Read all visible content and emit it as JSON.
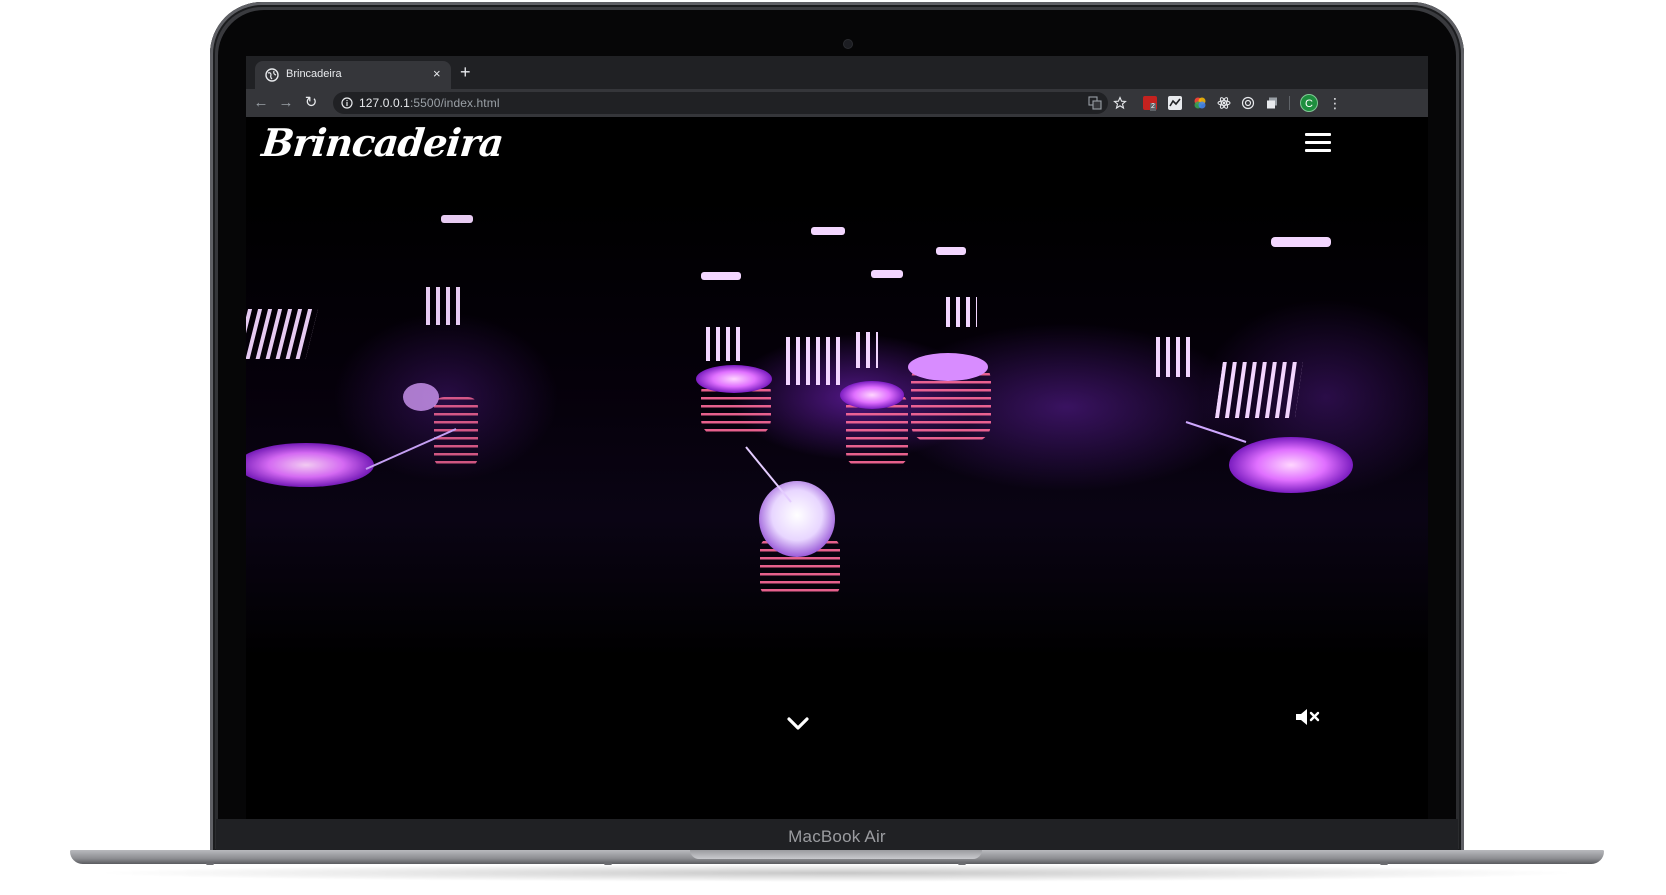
{
  "device": {
    "model_label": "MacBook Air"
  },
  "browser": {
    "tab": {
      "title": "Brincadeira",
      "close_glyph": "×",
      "favicon": "globe-icon"
    },
    "new_tab_glyph": "+",
    "url_host": "127.0.0.1",
    "url_rest": ":5500/index.html",
    "nav": {
      "back_glyph": "←",
      "forward_glyph": "→",
      "reload_glyph": "↻"
    },
    "extension_badge": "2",
    "profile_initial": "C",
    "menu_glyph": "⋮"
  },
  "site": {
    "brand": "Brincadeira",
    "menu_icon": "hamburger-icon",
    "scroll_icon": "chevron-down-icon",
    "sound_icon": "speaker-muted-icon",
    "accent_color": "#b040ff"
  }
}
